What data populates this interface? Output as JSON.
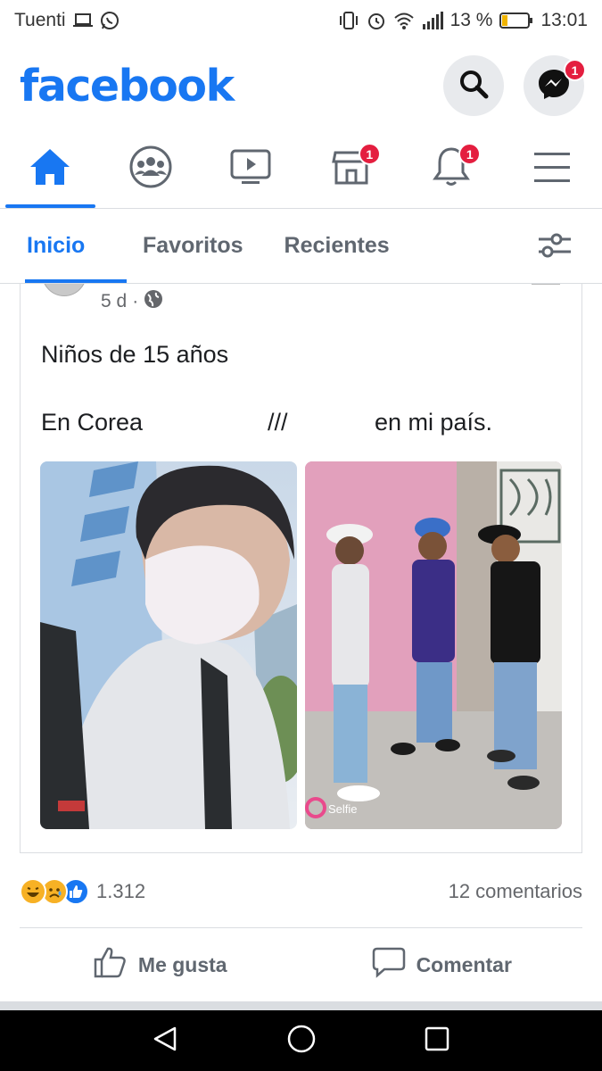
{
  "status_bar": {
    "carrier": "Tuenti",
    "battery_percent": "13 %",
    "time": "13:01"
  },
  "header": {
    "logo": "facebook",
    "messenger_badge": "1"
  },
  "main_tabs": {
    "active": "home",
    "marketplace_badge": "1",
    "notifications_badge": "1"
  },
  "subtabs": [
    {
      "label": "Inicio",
      "active": true
    },
    {
      "label": "Favoritos",
      "active": false
    },
    {
      "label": "Recientes",
      "active": false
    }
  ],
  "post": {
    "time": "5 d",
    "separator": "·",
    "text_line1": "Niños de 15 años",
    "text_line2_left": "En Corea",
    "text_line2_mid": "///",
    "text_line2_right": "en mi país.",
    "photo_left_caption": "",
    "photo_right_watermark": "Selfie"
  },
  "reactions": {
    "count": "1.312",
    "comments": "12 comentarios",
    "icons": [
      "laugh-emoji",
      "sad-emoji",
      "like-icon"
    ]
  },
  "actions": {
    "like": "Me gusta",
    "comment": "Comentar"
  },
  "colors": {
    "brand": "#1877f2",
    "badge": "#e41e3f"
  }
}
